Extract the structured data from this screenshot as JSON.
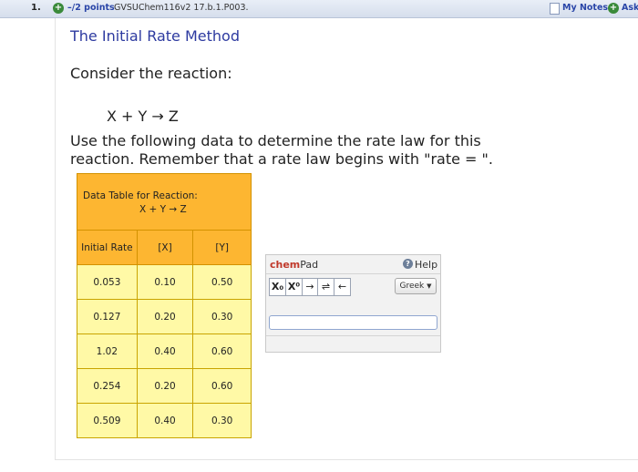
{
  "header": {
    "question_number": "1.",
    "points": "–/2 points",
    "question_ref": "GVSUChem116v2 17.b.1.P003.",
    "my_notes": "My Notes",
    "ask": "Ask"
  },
  "problem": {
    "title": "The Initial Rate Method",
    "consider": "Consider the reaction:",
    "reaction": "X + Y → Z",
    "instructions": "Use the following data to determine the rate law for this reaction. Remember that a rate law begins with \"rate = \"."
  },
  "data_table": {
    "caption_line1": "Data Table for Reaction:",
    "caption_reaction": "X + Y → Z",
    "headers": [
      "Initial Rate",
      "[X]",
      "[Y]"
    ],
    "rows": [
      [
        "0.053",
        "0.10",
        "0.50"
      ],
      [
        "0.127",
        "0.20",
        "0.30"
      ],
      [
        "1.02",
        "0.40",
        "0.60"
      ],
      [
        "0.254",
        "0.20",
        "0.60"
      ],
      [
        "0.509",
        "0.40",
        "0.30"
      ]
    ]
  },
  "chempad": {
    "title_chem": "chem",
    "title_pad": "Pad",
    "help": "Help",
    "subscript_button": "X₀",
    "superscript_button": "X⁰",
    "arrow_button": "→",
    "equilibrium_button": "⇌",
    "backspace_button": "←",
    "greek_label": "Greek",
    "answer_value": ""
  },
  "colors": {
    "accent": "#2d3aa0",
    "table_header": "#fdb631",
    "table_cell": "#fff9a6",
    "chem_red": "#c0392b"
  }
}
